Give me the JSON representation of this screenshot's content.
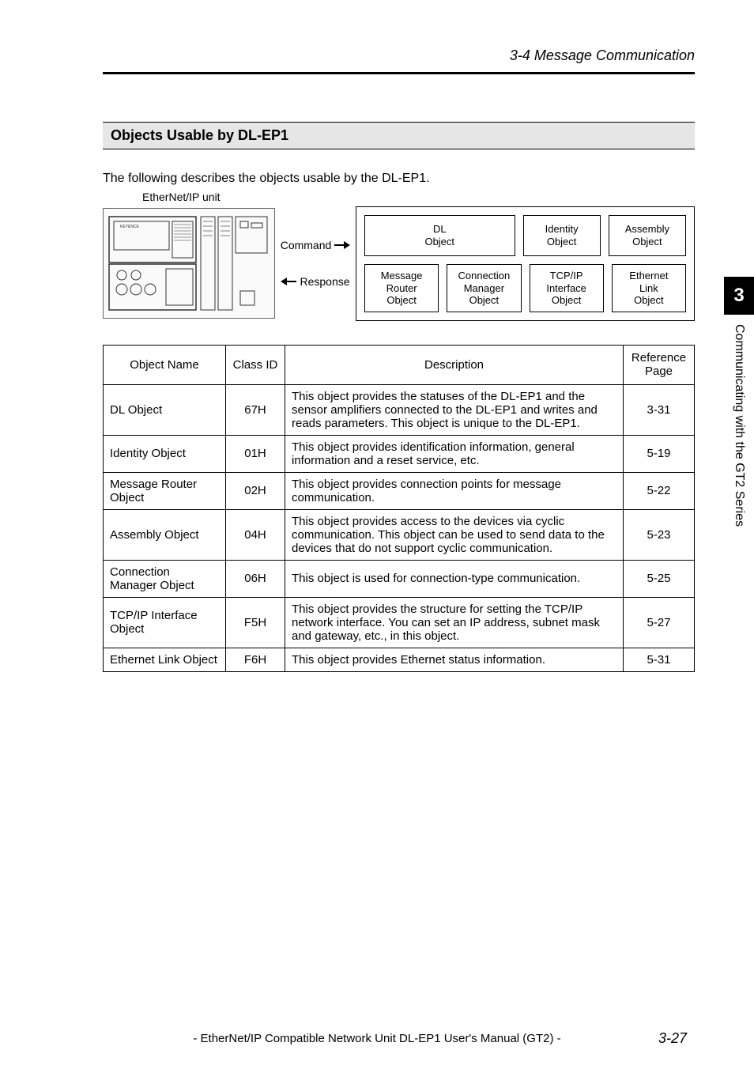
{
  "section_header": "3-4 Message Communication",
  "section_title": "Objects Usable by DL-EP1",
  "intro": "The following describes the objects usable by the DL-EP1.",
  "diagram": {
    "device_label": "EtherNet/IP unit",
    "command": "Command",
    "response": "Response",
    "objects_top": [
      "DL\nObject",
      "Identity\nObject",
      "Assembly\nObject"
    ],
    "objects_bottom": [
      "Message\nRouter\nObject",
      "Connection\nManager\nObject",
      "TCP/IP\nInterface\nObject",
      "Ethernet\nLink\nObject"
    ]
  },
  "table": {
    "headers": {
      "name": "Object Name",
      "class": "Class ID",
      "desc": "Description",
      "ref": "Reference Page"
    },
    "rows": [
      {
        "name": "DL Object",
        "class": "67H",
        "desc": "This object provides the statuses of the DL-EP1 and the sensor amplifiers connected to the DL-EP1 and writes and reads parameters. This object is unique to the DL-EP1.",
        "ref": "3-31"
      },
      {
        "name": "Identity Object",
        "class": "01H",
        "desc": "This object provides identification information, general information and a reset service, etc.",
        "ref": "5-19"
      },
      {
        "name": "Message Router Object",
        "class": "02H",
        "desc": "This object provides connection points for message communication.",
        "ref": "5-22"
      },
      {
        "name": "Assembly Object",
        "class": "04H",
        "desc": "This object provides access to the devices via cyclic communication. This object can be used to send data to the devices that do not support cyclic communication.",
        "ref": "5-23"
      },
      {
        "name": "Connection Manager Object",
        "class": "06H",
        "desc": "This object is used for connection-type communication.",
        "ref": "5-25"
      },
      {
        "name": "TCP/IP Interface Object",
        "class": "F5H",
        "desc": "This object provides the structure for setting the TCP/IP network interface. You can set an IP address, subnet mask and gateway, etc., in this object.",
        "ref": "5-27"
      },
      {
        "name": "Ethernet Link Object",
        "class": "F6H",
        "desc": "This object provides Ethernet status information.",
        "ref": "5-31"
      }
    ]
  },
  "tab": {
    "number": "3",
    "text": "Communicating with the GT2 Series"
  },
  "footer": "- EtherNet/IP Compatible Network Unit DL-EP1 User's Manual (GT2) -",
  "page_num": "3-27"
}
